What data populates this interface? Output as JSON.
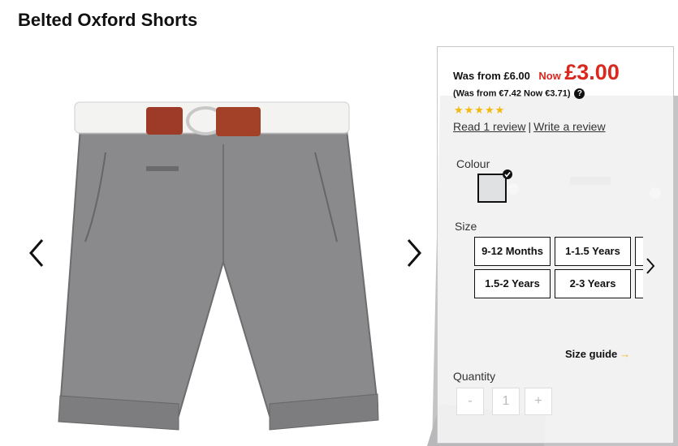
{
  "product": {
    "title": "Belted Oxford Shorts"
  },
  "price": {
    "was": "Was from £6.00",
    "now_label": "Now",
    "now": "£3.00",
    "euro": "(Was from €7.42 Now €3.71)",
    "help_glyph": "?"
  },
  "rating": {
    "stars_glyph": "★★★★★",
    "stars": 5
  },
  "reviews": {
    "read": "Read 1 review",
    "separator": "|",
    "write": "Write a review"
  },
  "colour": {
    "label": "Colour",
    "selected_swatch": "#dfe1e3"
  },
  "size": {
    "label": "Size",
    "options": [
      "9-12 Months",
      "1-1.5 Years",
      "1.5-2 Years",
      "2-3 Years"
    ]
  },
  "size_guide": {
    "label": "Size guide",
    "arrow": "→"
  },
  "quantity": {
    "label": "Quantity",
    "minus": "-",
    "value": "1",
    "plus": "+"
  },
  "colors": {
    "price_red": "#d9281e",
    "star_yellow": "#f2b90f"
  },
  "icons": {
    "prev": "chevron-left-icon",
    "next": "chevron-right-icon",
    "size_next": "chevron-right-icon",
    "help": "question-circle-icon",
    "check": "check-icon"
  }
}
